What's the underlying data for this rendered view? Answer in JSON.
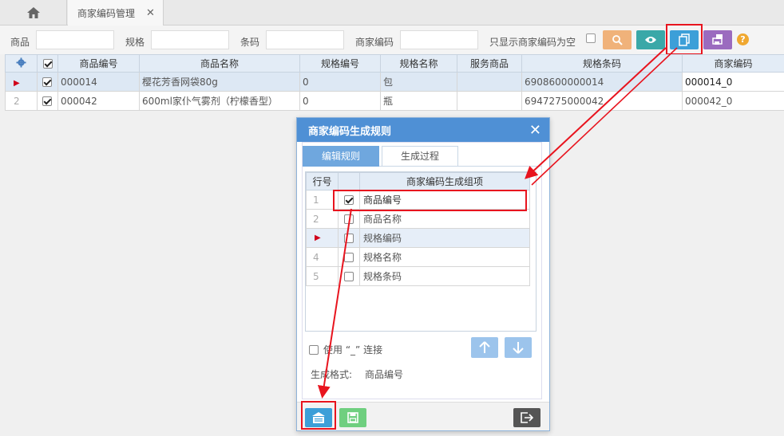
{
  "tabs": {
    "active_label": "商家编码管理",
    "close_glyph": "✕"
  },
  "filter": {
    "product_label": "商品",
    "spec_label": "规格",
    "barcode_label": "条码",
    "merchant_code_label": "商家编码",
    "empty_only_label": "只显示商家编码为空"
  },
  "toolbar_colors": {
    "search": "#f0b27a",
    "view": "#3aa8a8",
    "generate": "#3c9fd8",
    "print": "#9b6bbf",
    "help": "#f0a830"
  },
  "grid": {
    "columns": [
      "商品编号",
      "商品名称",
      "规格编号",
      "规格名称",
      "服务商品",
      "规格条码",
      "商家编码"
    ],
    "rows": [
      {
        "marker": "▶",
        "code": "000014",
        "name": "樱花芳香网袋80g",
        "spec_code": "0",
        "spec_name": "包",
        "service": "",
        "barcode": "6908600000014",
        "merchant_code": "000014_0"
      },
      {
        "marker": "2",
        "code": "000042",
        "name": "600ml家仆气雾剂（柠檬香型）",
        "spec_code": "0",
        "spec_name": "瓶",
        "service": "",
        "barcode": "6947275000042",
        "merchant_code": "000042_0"
      }
    ]
  },
  "dialog": {
    "title": "商家编码生成规则",
    "close_glyph": "✕",
    "tab_edit": "编辑规则",
    "tab_process": "生成过程",
    "rule_header_row": "行号",
    "rule_header_item": "商家编码生成组项",
    "rules": [
      {
        "row": "1",
        "checked": true,
        "label": "商品编号"
      },
      {
        "row": "2",
        "checked": false,
        "label": "商品名称"
      },
      {
        "row": "▶",
        "checked": false,
        "label": "规格编码"
      },
      {
        "row": "4",
        "checked": false,
        "label": "规格名称"
      },
      {
        "row": "5",
        "checked": false,
        "label": "规格条码"
      }
    ],
    "connect_label": "使用 “_” 连接",
    "format_label": "生成格式:",
    "format_value": "商品编号"
  }
}
